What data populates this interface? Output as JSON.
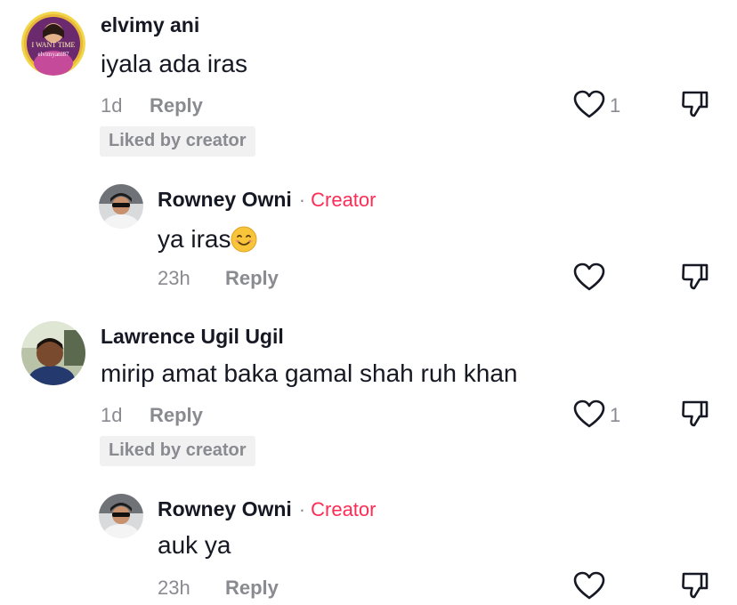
{
  "comments": [
    {
      "username": "elvimy ani",
      "text": "iyala ada iras",
      "time": "1d",
      "reply_label": "Reply",
      "liked_badge": "Liked by creator",
      "like_count": "1",
      "avatar_text_1": "I WANT TIME",
      "avatar_text_2": "elvimyani87"
    },
    {
      "username": "Rowney Owni",
      "separator": "·",
      "creator_label": "Creator",
      "text": "ya iras",
      "time": "23h",
      "reply_label": "Reply"
    },
    {
      "username": "Lawrence Ugil Ugil",
      "text": "mirip amat baka gamal shah ruh khan",
      "time": "1d",
      "reply_label": "Reply",
      "liked_badge": "Liked by creator",
      "like_count": "1"
    },
    {
      "username": "Rowney Owni",
      "separator": "·",
      "creator_label": "Creator",
      "text": "auk ya",
      "time": "23h",
      "reply_label": "Reply"
    }
  ],
  "icons": {
    "like": "heart-outline-icon",
    "dislike": "thumbs-down-icon",
    "emoji": "smiling-face-emoji"
  },
  "colors": {
    "creator_accent": "#fe2c55",
    "secondary_text": "#8a8b91",
    "badge_bg": "#f1f1f2"
  }
}
